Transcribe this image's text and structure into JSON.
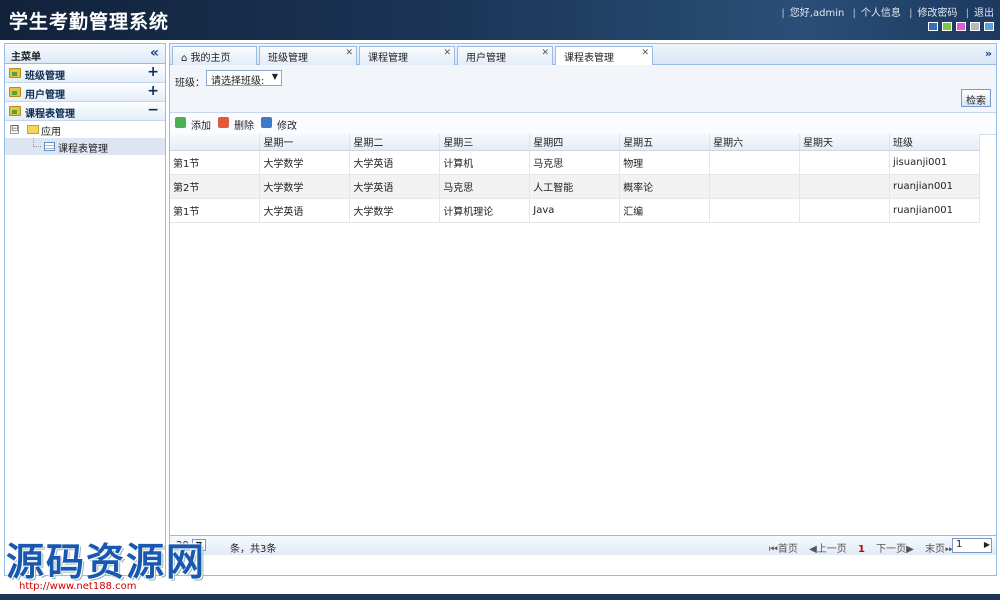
{
  "header": {
    "title": "学生考勤管理系统",
    "greeting": "您好,admin",
    "links": [
      "个人信息",
      "修改密码",
      "退出"
    ],
    "themes": [
      "#2f6fc2",
      "#7ac943",
      "#e25ad6",
      "#b8b8b8",
      "#5aa0d8"
    ]
  },
  "sidebar": {
    "title": "主菜单",
    "sections": [
      {
        "label": "班级管理",
        "toggle": "+"
      },
      {
        "label": "用户管理",
        "toggle": "+"
      },
      {
        "label": "课程表管理",
        "toggle": "−"
      }
    ],
    "tree": {
      "folder": "应用",
      "toggle": "⊟",
      "leaf": "课程表管理"
    }
  },
  "tabs": [
    {
      "label": "我的主页"
    },
    {
      "label": "班级管理"
    },
    {
      "label": "课程管理"
    },
    {
      "label": "用户管理"
    },
    {
      "label": "课程表管理"
    }
  ],
  "filter": {
    "label": "班级：",
    "selected": "请选择班级:",
    "search": "检索"
  },
  "toolbar": {
    "add": "添加",
    "delete": "删除",
    "edit": "修改"
  },
  "grid": {
    "columns": [
      "",
      "星期一",
      "星期二",
      "星期三",
      "星期四",
      "星期五",
      "星期六",
      "星期天",
      "班级"
    ],
    "rows": [
      [
        "第1节",
        "大学数学",
        "大学英语",
        "计算机",
        "马克思",
        "物理",
        "",
        "",
        "jisuanji001"
      ],
      [
        "第2节",
        "大学数学",
        "大学英语",
        "马克思",
        "人工智能",
        "概率论",
        "",
        "",
        "ruanjian001"
      ],
      [
        "第1节",
        "大学英语",
        "大学数学",
        "计算机理论",
        "Java",
        "汇编",
        "",
        "",
        "ruanjian001"
      ]
    ]
  },
  "pager": {
    "size": "20",
    "total": "条，共3条",
    "first": "首页",
    "prev": "上一页",
    "current": "1",
    "next": "下一页",
    "last": "末页",
    "page_value": "1"
  },
  "watermark": {
    "text": "源码资源网",
    "url": "http://www.net188.com"
  }
}
